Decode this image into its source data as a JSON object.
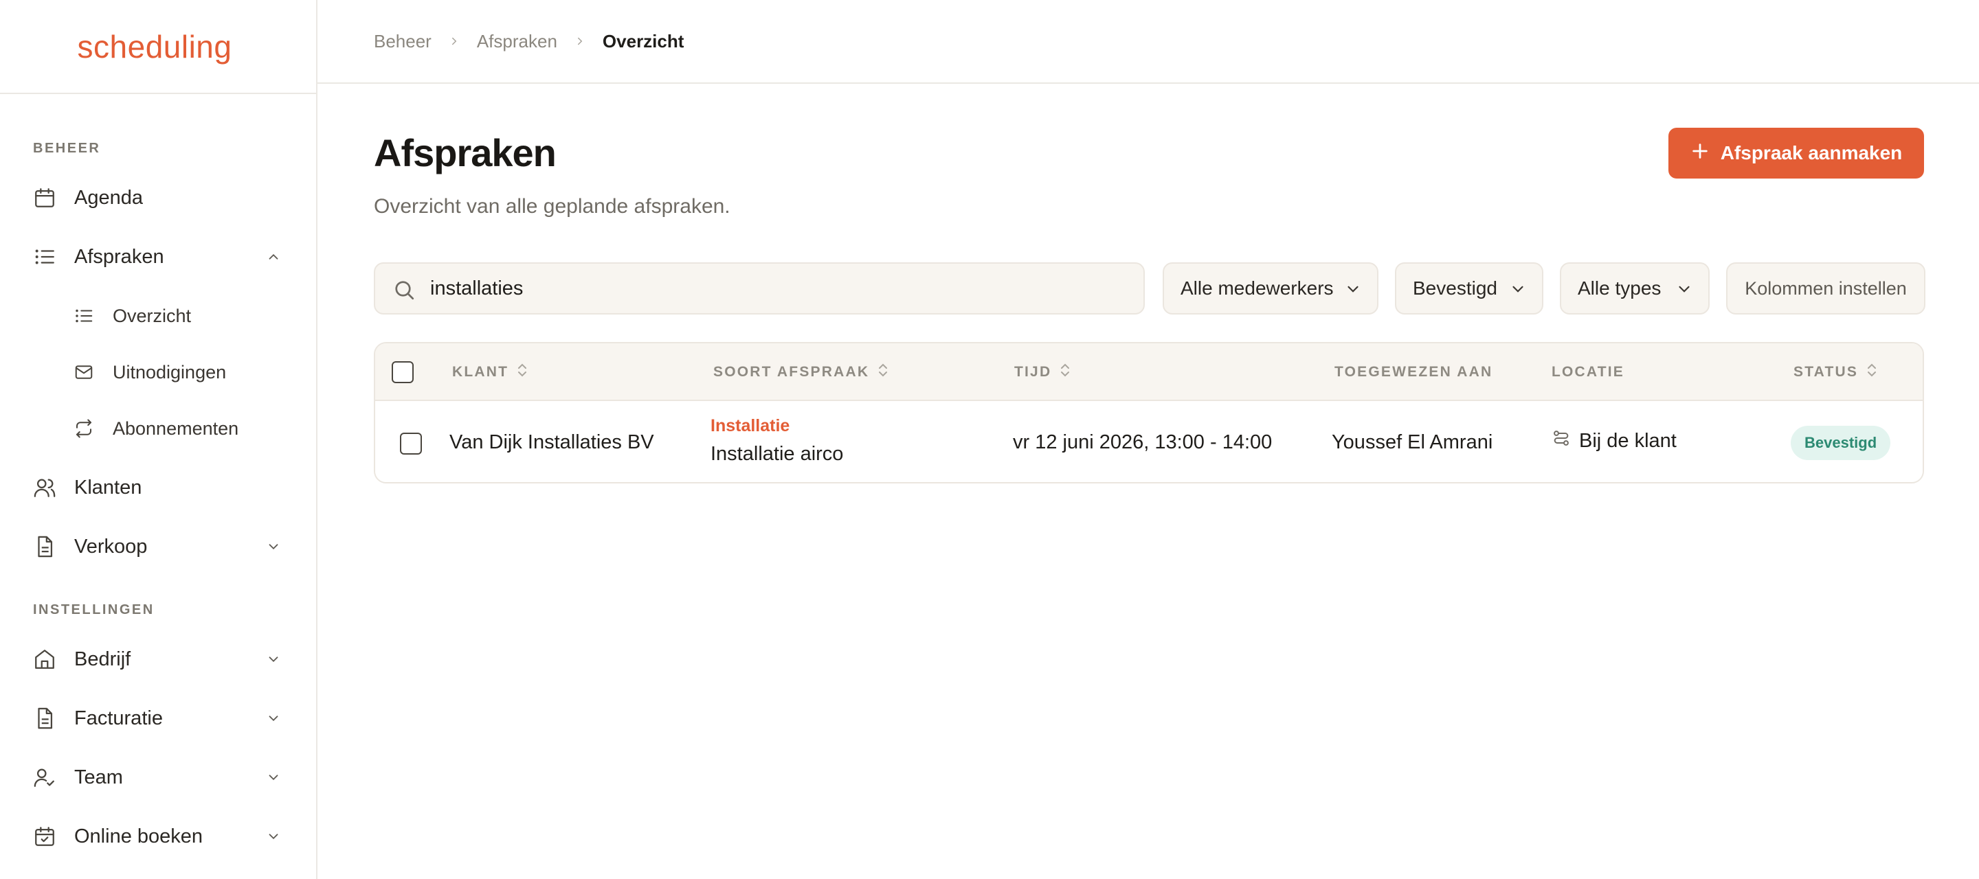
{
  "brand": {
    "logo": "scheduling"
  },
  "sidebar": {
    "sections": [
      {
        "label": "BEHEER"
      },
      {
        "label": "INSTELLINGEN"
      }
    ],
    "items": [
      {
        "label": "Agenda"
      },
      {
        "label": "Afspraken"
      },
      {
        "label": "Klanten"
      },
      {
        "label": "Verkoop"
      },
      {
        "label": "Bedrijf"
      },
      {
        "label": "Facturatie"
      },
      {
        "label": "Team"
      },
      {
        "label": "Online boeken"
      }
    ],
    "subitems": [
      {
        "label": "Overzicht"
      },
      {
        "label": "Uitnodigingen"
      },
      {
        "label": "Abonnementen"
      }
    ]
  },
  "breadcrumb": [
    "Beheer",
    "Afspraken",
    "Overzicht"
  ],
  "page": {
    "title": "Afspraken",
    "subtitle": "Overzicht van alle geplande afspraken.",
    "primary_button": "Afspraak aanmaken"
  },
  "filters": {
    "search_value": "installaties",
    "employees": "Alle medewerkers",
    "status": "Bevestigd",
    "types": "Alle types",
    "columns_button": "Kolommen instellen"
  },
  "table": {
    "columns": [
      "KLANT",
      "SOORT AFSPRAAK",
      "TIJD",
      "TOEGEWEZEN AAN",
      "LOCATIE",
      "STATUS"
    ],
    "rows": [
      {
        "client": "Van Dijk Installaties BV",
        "type_tag": "Installatie",
        "type_name": "Installatie airco",
        "time": "vr 12 juni 2026, 13:00 - 14:00",
        "assigned": "Youssef El Amrani",
        "location": "Bij de klant",
        "status": "Bevestigd"
      }
    ]
  },
  "colors": {
    "accent": "#e35d35",
    "status_confirmed_bg": "#e3f4ef",
    "status_confirmed_text": "#2c8a72"
  }
}
